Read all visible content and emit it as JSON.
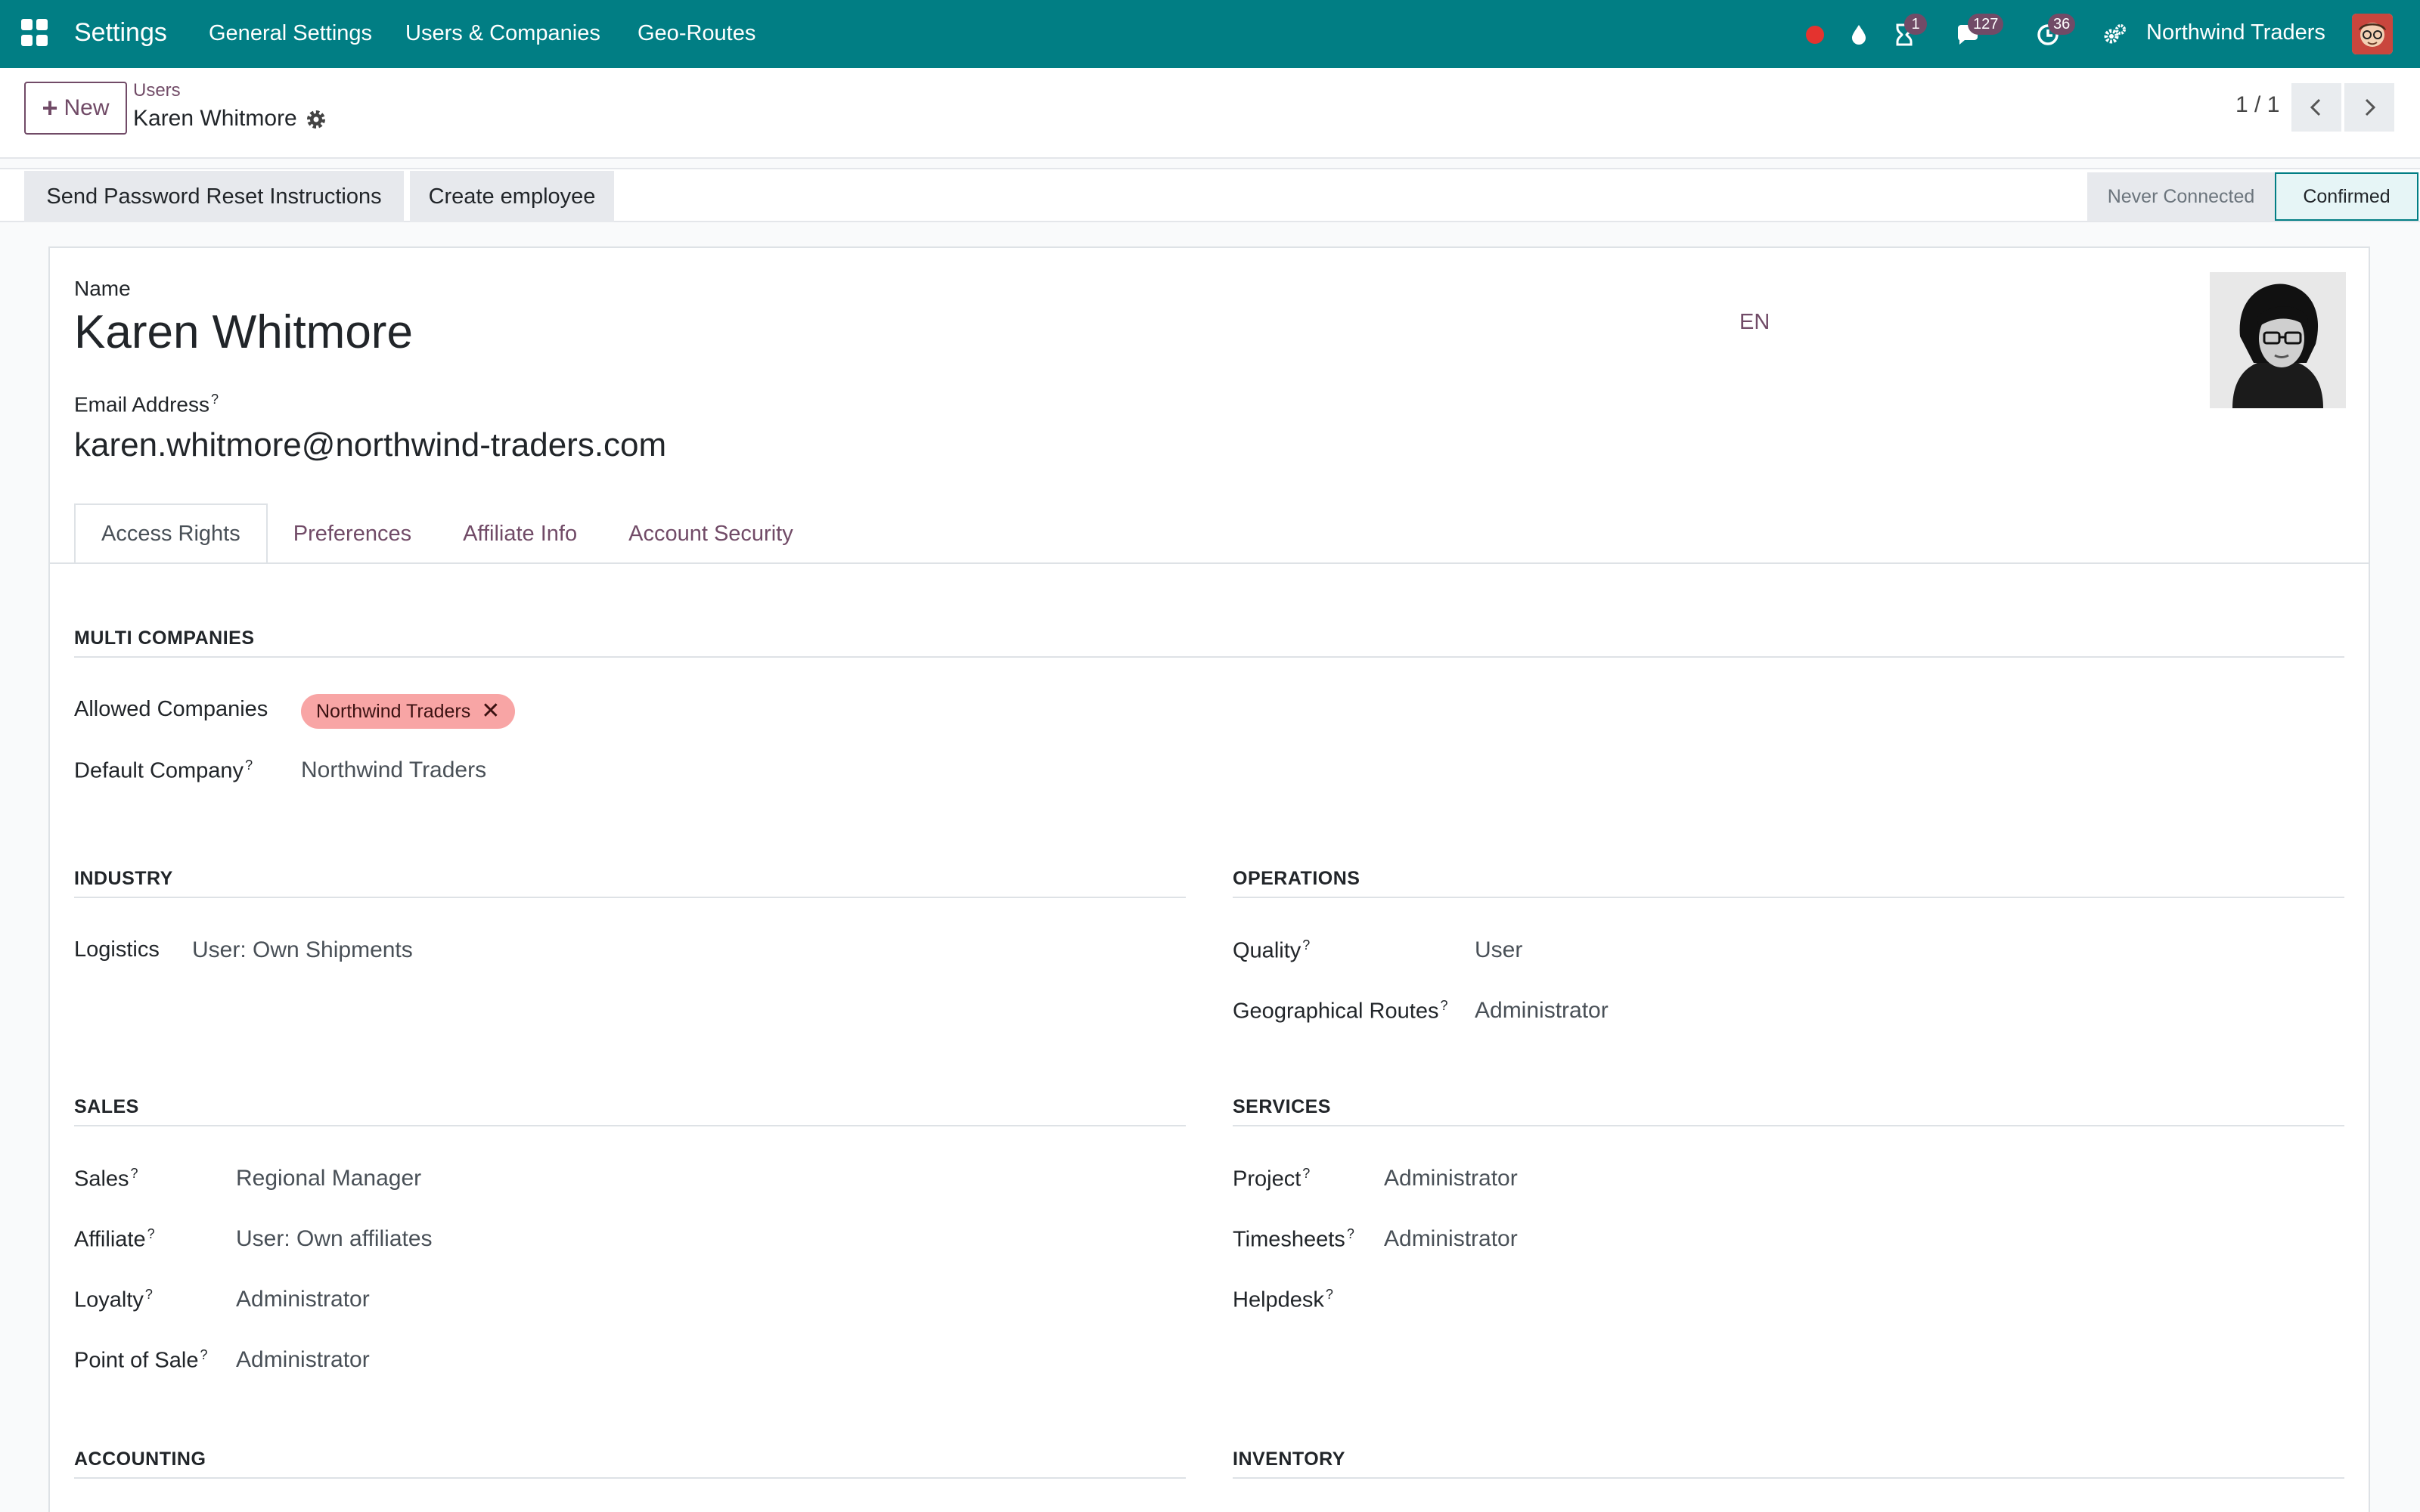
{
  "topnav": {
    "app_title": "Settings",
    "menu": [
      "General Settings",
      "Users & Companies",
      "Geo-Routes"
    ],
    "icons": [
      {
        "name": "recording-dot-icon",
        "color": "#e4332f"
      },
      {
        "name": "drop-icon"
      },
      {
        "name": "hourglass-icon",
        "badge": "1"
      },
      {
        "name": "chat-icon",
        "badge": "127"
      },
      {
        "name": "activity-clock-icon",
        "badge": "36"
      },
      {
        "name": "gears-icon"
      }
    ],
    "company": "Northwind Traders",
    "brand_color": "#017e84",
    "accent_color": "#714b67"
  },
  "control_panel": {
    "new_label": "New",
    "breadcrumb_parent": "Users",
    "record_title": "Karen Whitmore",
    "pager": "1 / 1"
  },
  "statusbar": {
    "actions": [
      "Send Password Reset Instructions",
      "Create employee"
    ],
    "stages": [
      "Never Connected",
      "Confirmed"
    ],
    "active_stage": "Confirmed"
  },
  "form": {
    "name_label": "Name",
    "name_value": "Karen Whitmore",
    "email_label": "Email Address",
    "email_value": "karen.whitmore@northwind-traders.com",
    "help_mark": "?",
    "language": "EN",
    "tabs": [
      "Access Rights",
      "Preferences",
      "Affiliate Info",
      "Account Security"
    ],
    "active_tab": "Access Rights"
  },
  "sections": {
    "multi_companies": {
      "title": "MULTI COMPANIES",
      "allowed_label": "Allowed Companies",
      "allowed_tag": "Northwind Traders",
      "remove_mark": "✕",
      "default_label": "Default Company",
      "default_value": "Northwind Traders"
    },
    "industry": {
      "title": "INDUSTRY",
      "fields": [
        {
          "label": "Logistics",
          "value": "User: Own Shipments"
        }
      ]
    },
    "operations": {
      "title": "OPERATIONS",
      "fields": [
        {
          "label": "Quality",
          "value": "User"
        },
        {
          "label": "Geographical Routes",
          "value": "Administrator"
        }
      ]
    },
    "sales": {
      "title": "SALES",
      "fields": [
        {
          "label": "Sales",
          "value": "Regional Manager"
        },
        {
          "label": "Affiliate",
          "value": "User: Own affiliates"
        },
        {
          "label": "Loyalty",
          "value": "Administrator"
        },
        {
          "label": "Point of Sale",
          "value": "Administrator"
        }
      ]
    },
    "services": {
      "title": "SERVICES",
      "fields": [
        {
          "label": "Project",
          "value": "Administrator"
        },
        {
          "label": "Timesheets",
          "value": "Administrator"
        },
        {
          "label": "Helpdesk",
          "value": ""
        }
      ]
    },
    "accounting": {
      "title": "ACCOUNTING"
    },
    "inventory": {
      "title": "INVENTORY"
    }
  }
}
